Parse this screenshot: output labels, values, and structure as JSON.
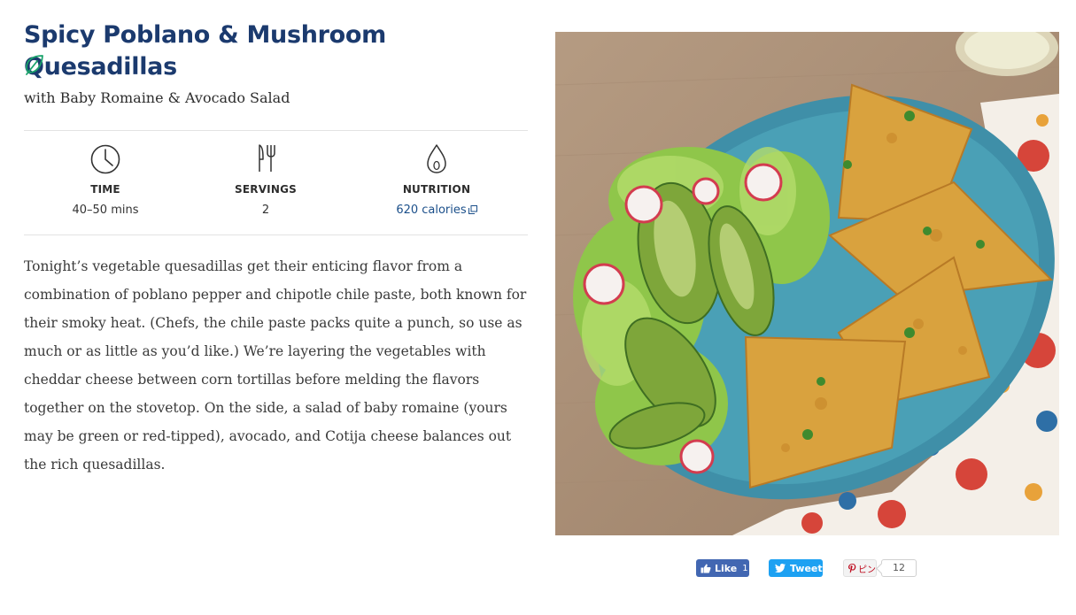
{
  "recipe": {
    "title": "Spicy Poblano & Mushroom Quesadillas",
    "subtitle": "with Baby Romaine & Avocado Salad",
    "badge_icon": "leaf-icon",
    "description": "Tonight’s vegetable quesadillas get their enticing flavor from a combination of poblano pepper and chipotle chile paste, both known for their smoky heat. (Chefs, the chile paste packs quite a punch, so use as much or as little as you’d like.) We’re layering the vegetables with cheddar cheese between corn tortillas before melding the flavors together on the stovetop. On the side, a salad of baby romaine (yours may be green or red-tipped), avocado, and Cotija cheese balances out the rich quesadillas."
  },
  "stats": {
    "time": {
      "icon": "clock-icon",
      "label": "TIME",
      "value": "40–50 mins"
    },
    "servings": {
      "icon": "fork-knife-icon",
      "label": "SERVINGS",
      "value": "2"
    },
    "nutrition": {
      "icon": "drop-icon",
      "label": "NUTRITION",
      "value": "620 calories"
    }
  },
  "social": {
    "facebook": {
      "label": "Like",
      "count": "1"
    },
    "twitter": {
      "label": "Tweet"
    },
    "pinterest": {
      "label": "ピン",
      "count": "12"
    }
  },
  "colors": {
    "title": "#1b3a6e",
    "accent_green": "#1aa36b",
    "link": "#1b4f8a",
    "facebook": "#4267b2",
    "twitter": "#1da1f2"
  }
}
